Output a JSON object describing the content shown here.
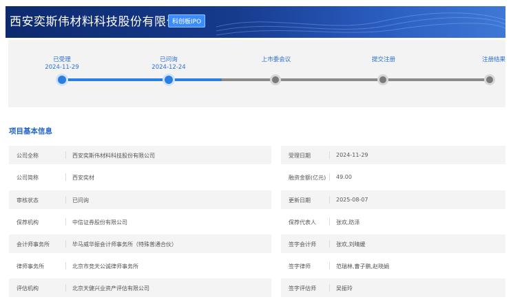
{
  "header": {
    "company_title": "西安奕斯伟材料科技股份有限公司",
    "board_badge": "科创板IPO"
  },
  "timeline": {
    "steps": [
      {
        "label": "已受理",
        "date": "2024-11-29",
        "state": "done"
      },
      {
        "label": "已问询",
        "date": "2024-12-24",
        "state": "done"
      },
      {
        "label": "上市委会议",
        "date": "",
        "state": "pending"
      },
      {
        "label": "提交注册",
        "date": "",
        "state": "pending"
      },
      {
        "label": "注册结果",
        "date": "",
        "state": "pending"
      }
    ],
    "colors": {
      "done": "#2a7de1",
      "pending": "#7a7a7a"
    }
  },
  "basic_info": {
    "section_title": "项目基本信息",
    "left": [
      {
        "key": "公司全称",
        "value": "西安奕斯伟材料科技股份有限公司"
      },
      {
        "key": "公司简称",
        "value": "西安奕材"
      },
      {
        "key": "审核状态",
        "value": "已问询"
      },
      {
        "key": "保荐机构",
        "value": "中信证券股份有限公司"
      },
      {
        "key": "会计师事务所",
        "value": "毕马威华振会计师事务所（特殊普通合伙）"
      },
      {
        "key": "律师事务所",
        "value": "北京市竞天公诚律师事务所"
      },
      {
        "key": "评估机构",
        "value": "北京天健兴业资产评估有限公司"
      }
    ],
    "right": [
      {
        "key": "受理日期",
        "value": "2024-11-29"
      },
      {
        "key": "融资金额(亿元)",
        "value": "49.00"
      },
      {
        "key": "更新日期",
        "value": "2025-08-07"
      },
      {
        "key": "保荐代表人",
        "value": "张欢,昉泽"
      },
      {
        "key": "签字会计师",
        "value": "张欢,刘晴媛"
      },
      {
        "key": "签字律师",
        "value": "范瑞林,曹子鹏,赵晓娟"
      },
      {
        "key": "签字评估师",
        "value": "吴振玲"
      }
    ]
  }
}
